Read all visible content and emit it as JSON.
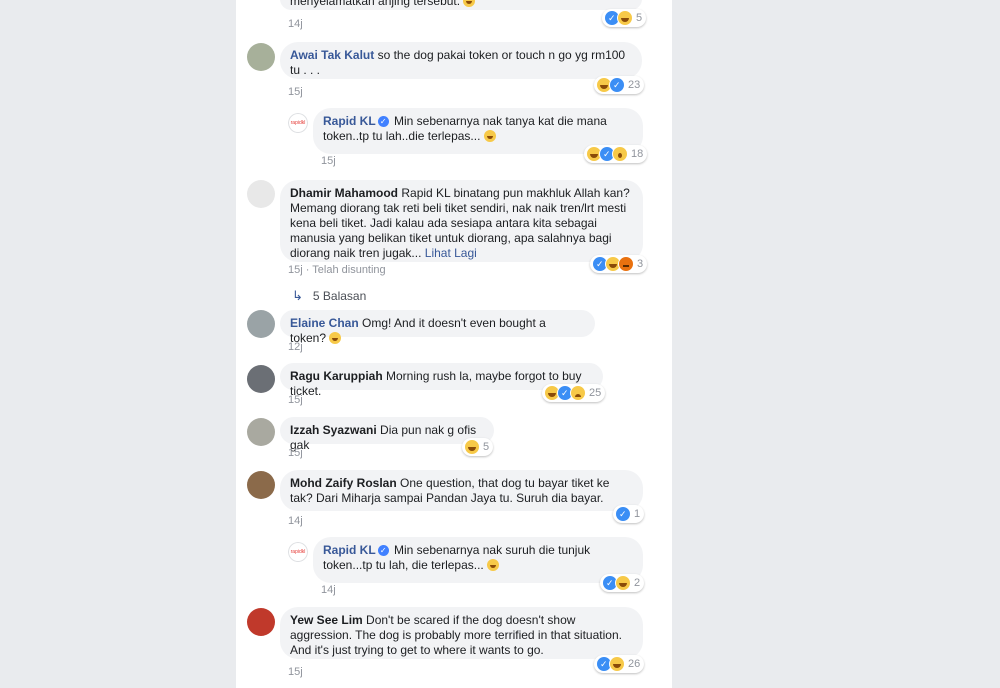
{
  "comments": [
    {
      "id": "c0",
      "author": "",
      "text": "menyelamatkan anjing tersebut.",
      "time": "14j",
      "reaction_count": "5"
    },
    {
      "id": "c1",
      "author": "Awai Tak Kalut",
      "text": "so the dog pakai token or touch n go yg rm100 tu . . .",
      "time": "15j",
      "reaction_count": "23"
    },
    {
      "id": "c2",
      "author": "Rapid KL",
      "text": "Min sebenarnya nak tanya kat die mana token..tp tu lah..die terlepas...",
      "time": "15j",
      "reaction_count": "18"
    },
    {
      "id": "c3",
      "author": "Dhamir Mahamood",
      "text": "Rapid KL binatang pun makhluk Allah kan? Memang diorang tak reti beli tiket sendiri, nak naik tren/lrt mesti kena beli tiket. Jadi kalau ada sesiapa antara kita sebagai manusia yang belikan tiket untuk diorang, apa salahnya bagi diorang naik tren jugak...",
      "see_more": "Lihat Lagi",
      "time": "15j",
      "edited": "Telah disunting",
      "reaction_count": "3",
      "replies_label": "5 Balasan"
    },
    {
      "id": "c4",
      "author": "Elaine Chan",
      "text": "Omg! And it doesn't even bought a token?",
      "time": "12j"
    },
    {
      "id": "c5",
      "author": "Ragu Karuppiah",
      "text": "Morning rush la, maybe forgot to buy ticket.",
      "time": "15j",
      "reaction_count": "25"
    },
    {
      "id": "c6",
      "author": "Izzah Syazwani",
      "text": "Dia pun nak g ofis gak",
      "time": "15j",
      "reaction_count": "5"
    },
    {
      "id": "c7",
      "author": "Mohd Zaify Roslan",
      "text": "One question, that dog tu bayar tiket ke tak? Dari Miharja sampai Pandan Jaya tu. Suruh dia bayar.",
      "time": "14j",
      "reaction_count": "1"
    },
    {
      "id": "c8",
      "author": "Rapid KL",
      "text": "Min sebenarnya nak suruh die tunjuk token...tp tu lah, die terlepas...",
      "time": "14j",
      "reaction_count": "2"
    },
    {
      "id": "c9",
      "author": "Yew See Lim",
      "text": "Don't be scared if the dog doesn't show aggression. The dog is probably more terrified in that situation. And it's just trying to get to where it wants to go.",
      "time": "15j",
      "reaction_count": "26"
    }
  ],
  "logo_text": "rapidkl",
  "separator": "·"
}
